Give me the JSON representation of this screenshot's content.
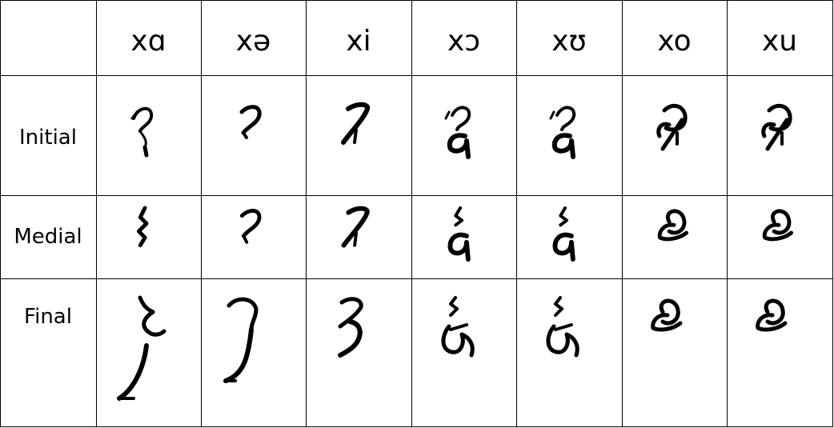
{
  "table": {
    "columns": [
      "xɑ",
      "xə",
      "xi",
      "xɔ",
      "xʊ",
      "xo",
      "xu"
    ],
    "rows": [
      {
        "label": "Initial"
      },
      {
        "label": "Medial"
      },
      {
        "label": "Final"
      }
    ]
  }
}
